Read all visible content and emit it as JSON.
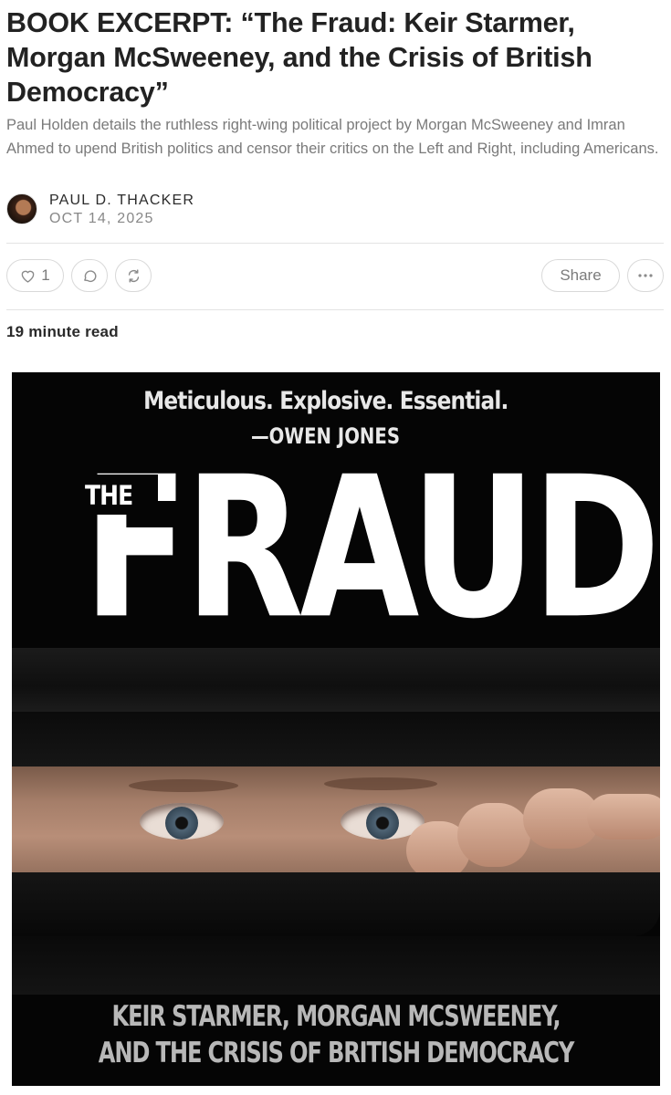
{
  "article": {
    "title": "BOOK EXCERPT: “The Fraud: Keir Starmer, Morgan McSweeney, and the Crisis of British Democracy”",
    "subtitle": "Paul Holden details the ruthless right-wing political project by Morgan McSweeney and Imran Ahmed to upend British politics and censor their critics on the Left and Right, including Americans.",
    "author": "PAUL D. THACKER",
    "date": "OCT 14, 2025",
    "read_time": "19 minute read"
  },
  "actions": {
    "like_count": "1",
    "share_label": "Share",
    "like_icon": "heart-icon",
    "comment_icon": "comment-icon",
    "restack_icon": "restack-icon",
    "more_icon": "more-icon"
  },
  "cover": {
    "blurb": "Meticulous. Explosive. Essential.",
    "attribution": "—OWEN JONES",
    "title_small": "THE",
    "title_large": "FRAUD",
    "bottom_line1": "KEIR STARMER,  MORGAN MCSWEENEY,",
    "bottom_line2": "AND THE CRISIS OF BRITISH DEMOCRACY"
  },
  "colors": {
    "text": "#222222",
    "muted": "#7a7a7a",
    "border": "#d9d9d9",
    "cover_bg": "#050505"
  }
}
